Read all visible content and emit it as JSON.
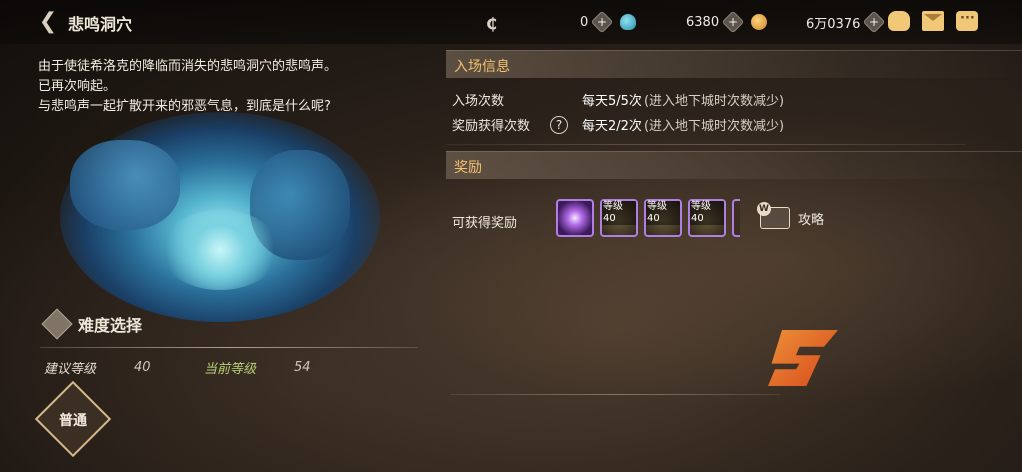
{
  "header": {
    "title": "悲鸣洞穴",
    "currencies": [
      {
        "icon": "cera-icon",
        "value": "0"
      },
      {
        "icon": "potion-icon",
        "value": "6380"
      },
      {
        "icon": "gold-coin-icon",
        "value": "6万0376"
      }
    ],
    "right_icons": [
      "bag-icon",
      "mail-icon",
      "chat-icon"
    ]
  },
  "left": {
    "description": [
      "由于使徒希洛克的降临而消失的悲鸣洞穴的悲鸣声。",
      "已再次响起。",
      "与悲鸣声一起扩散开来的邪恶气息，到底是什么呢?"
    ],
    "difficulty_title": "难度选择",
    "recommended_level_label": "建议等级",
    "recommended_level": "40",
    "current_level_label": "当前等级",
    "current_level": "54",
    "difficulty_button": "普通"
  },
  "entry": {
    "section_title": "入场信息",
    "entry_count_label": "入场次数",
    "entry_count_value": "每天5/5次",
    "entry_count_note": "(进入地下城时次数减少)",
    "reward_count_label": "奖励获得次数",
    "help_icon_text": "?",
    "reward_count_value": "每天2/2次",
    "reward_count_note": "(进入地下城时次数减少)"
  },
  "rewards": {
    "section_title": "奖励",
    "obtainable_label": "可获得奖励",
    "items": [
      {
        "tag": ""
      },
      {
        "tag": "等级40"
      },
      {
        "tag": "等级40"
      },
      {
        "tag": "等级40"
      }
    ],
    "guide_label": "攻略"
  },
  "colors": {
    "section_title": "#f3c170",
    "current_level_label": "#b8d27a",
    "item_border": "#b07fe0"
  }
}
